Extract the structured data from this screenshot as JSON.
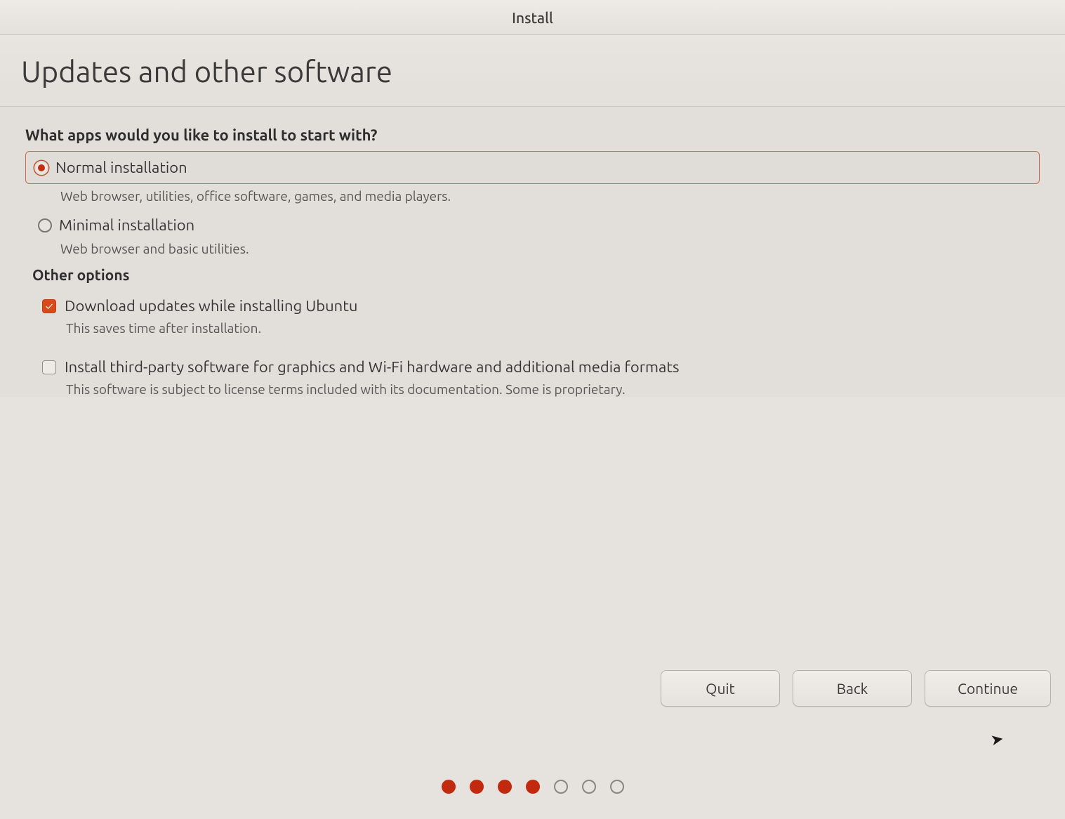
{
  "window": {
    "title": "Install"
  },
  "page": {
    "heading": "Updates and other software"
  },
  "apps_section": {
    "question": "What apps would you like to install to start with?",
    "options": [
      {
        "label": "Normal installation",
        "description": "Web browser, utilities, office software, games, and media players.",
        "selected": true
      },
      {
        "label": "Minimal installation",
        "description": "Web browser and basic utilities.",
        "selected": false
      }
    ]
  },
  "other_section": {
    "title": "Other options",
    "options": [
      {
        "label": "Download updates while installing Ubuntu",
        "description": "This saves time after installation.",
        "checked": true
      },
      {
        "label": "Install third-party software for graphics and Wi-Fi hardware and additional media formats",
        "description": "This software is subject to license terms included with its documentation. Some is proprietary.",
        "checked": false
      }
    ]
  },
  "buttons": {
    "quit": "Quit",
    "back": "Back",
    "continue": "Continue"
  },
  "pager": {
    "current": 4,
    "total": 7
  },
  "colors": {
    "accent": "#d94a1a",
    "border_accent": "#c96b4f"
  }
}
